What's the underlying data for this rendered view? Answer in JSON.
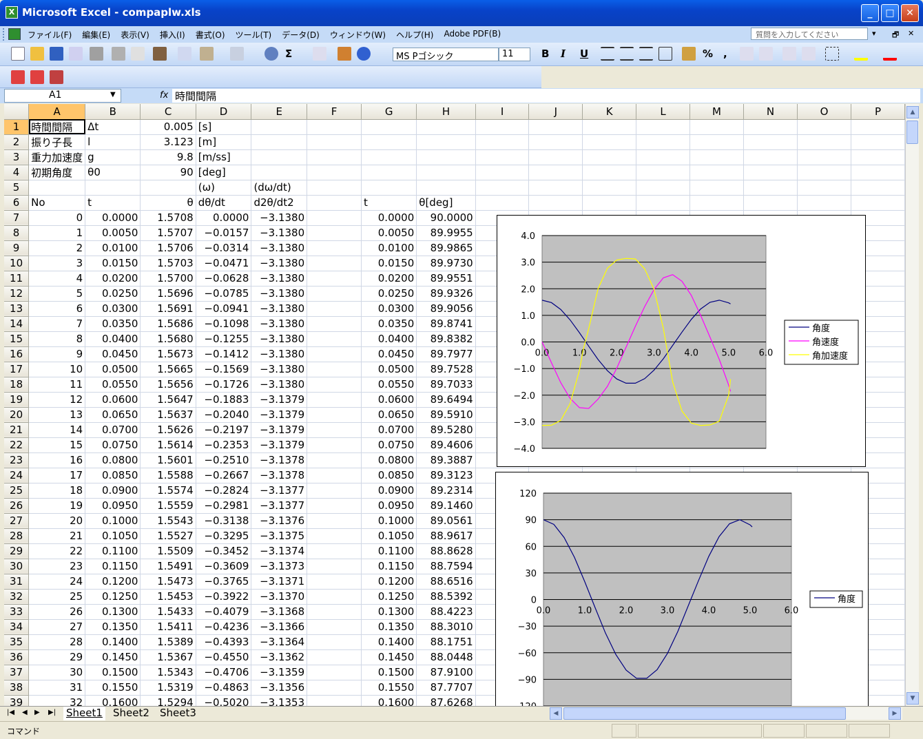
{
  "window": {
    "title": "Microsoft Excel - compaplw.xls",
    "app_icon": "X",
    "minimize": "_",
    "maximize": "□",
    "close": "✕"
  },
  "menu": {
    "items": [
      "ファイル(F)",
      "編集(E)",
      "表示(V)",
      "挿入(I)",
      "書式(O)",
      "ツール(T)",
      "データ(D)",
      "ウィンドウ(W)",
      "ヘルプ(H)",
      "Adobe PDF(B)"
    ],
    "help_placeholder": "質問を入力してください"
  },
  "toolbar": {
    "font_name": "MS Pゴシック",
    "font_size": "11",
    "bold": "B",
    "italic": "I",
    "underline": "U",
    "sigma": "Σ",
    "percent": "%",
    "comma": ","
  },
  "formula_bar": {
    "name_box": "A1",
    "fx": "fx",
    "content": "時間間隔"
  },
  "columns": [
    "A",
    "B",
    "C",
    "D",
    "E",
    "F",
    "G",
    "H",
    "I",
    "J",
    "K",
    "L",
    "M",
    "N",
    "O",
    "P"
  ],
  "rows": [
    [
      "時間間隔",
      "Δt",
      "0.005",
      "[s]",
      "",
      "",
      "",
      ""
    ],
    [
      "振り子長",
      "l",
      "3.123",
      "[m]",
      "",
      "",
      "",
      ""
    ],
    [
      "重力加速度",
      "g",
      "9.8",
      "[m/ss]",
      "",
      "",
      "",
      ""
    ],
    [
      "初期角度",
      "θ0",
      "90",
      "[deg]",
      "",
      "",
      "",
      ""
    ],
    [
      "",
      "",
      "",
      "(ω)",
      "(dω/dt)",
      "",
      "",
      ""
    ],
    [
      "No",
      "t",
      "θ",
      "dθ/dt",
      "d2θ/dt2",
      "",
      "t",
      "θ[deg]"
    ],
    [
      "0",
      "0.0000",
      "1.5708",
      "0.0000",
      "−3.1380",
      "",
      "0.0000",
      "90.0000"
    ],
    [
      "1",
      "0.0050",
      "1.5707",
      "−0.0157",
      "−3.1380",
      "",
      "0.0050",
      "89.9955"
    ],
    [
      "2",
      "0.0100",
      "1.5706",
      "−0.0314",
      "−3.1380",
      "",
      "0.0100",
      "89.9865"
    ],
    [
      "3",
      "0.0150",
      "1.5703",
      "−0.0471",
      "−3.1380",
      "",
      "0.0150",
      "89.9730"
    ],
    [
      "4",
      "0.0200",
      "1.5700",
      "−0.0628",
      "−3.1380",
      "",
      "0.0200",
      "89.9551"
    ],
    [
      "5",
      "0.0250",
      "1.5696",
      "−0.0785",
      "−3.1380",
      "",
      "0.0250",
      "89.9326"
    ],
    [
      "6",
      "0.0300",
      "1.5691",
      "−0.0941",
      "−3.1380",
      "",
      "0.0300",
      "89.9056"
    ],
    [
      "7",
      "0.0350",
      "1.5686",
      "−0.1098",
      "−3.1380",
      "",
      "0.0350",
      "89.8741"
    ],
    [
      "8",
      "0.0400",
      "1.5680",
      "−0.1255",
      "−3.1380",
      "",
      "0.0400",
      "89.8382"
    ],
    [
      "9",
      "0.0450",
      "1.5673",
      "−0.1412",
      "−3.1380",
      "",
      "0.0450",
      "89.7977"
    ],
    [
      "10",
      "0.0500",
      "1.5665",
      "−0.1569",
      "−3.1380",
      "",
      "0.0500",
      "89.7528"
    ],
    [
      "11",
      "0.0550",
      "1.5656",
      "−0.1726",
      "−3.1380",
      "",
      "0.0550",
      "89.7033"
    ],
    [
      "12",
      "0.0600",
      "1.5647",
      "−0.1883",
      "−3.1379",
      "",
      "0.0600",
      "89.6494"
    ],
    [
      "13",
      "0.0650",
      "1.5637",
      "−0.2040",
      "−3.1379",
      "",
      "0.0650",
      "89.5910"
    ],
    [
      "14",
      "0.0700",
      "1.5626",
      "−0.2197",
      "−3.1379",
      "",
      "0.0700",
      "89.5280"
    ],
    [
      "15",
      "0.0750",
      "1.5614",
      "−0.2353",
      "−3.1379",
      "",
      "0.0750",
      "89.4606"
    ],
    [
      "16",
      "0.0800",
      "1.5601",
      "−0.2510",
      "−3.1378",
      "",
      "0.0800",
      "89.3887"
    ],
    [
      "17",
      "0.0850",
      "1.5588",
      "−0.2667",
      "−3.1378",
      "",
      "0.0850",
      "89.3123"
    ],
    [
      "18",
      "0.0900",
      "1.5574",
      "−0.2824",
      "−3.1377",
      "",
      "0.0900",
      "89.2314"
    ],
    [
      "19",
      "0.0950",
      "1.5559",
      "−0.2981",
      "−3.1377",
      "",
      "0.0950",
      "89.1460"
    ],
    [
      "20",
      "0.1000",
      "1.5543",
      "−0.3138",
      "−3.1376",
      "",
      "0.1000",
      "89.0561"
    ],
    [
      "21",
      "0.1050",
      "1.5527",
      "−0.3295",
      "−3.1375",
      "",
      "0.1050",
      "88.9617"
    ],
    [
      "22",
      "0.1100",
      "1.5509",
      "−0.3452",
      "−3.1374",
      "",
      "0.1100",
      "88.8628"
    ],
    [
      "23",
      "0.1150",
      "1.5491",
      "−0.3609",
      "−3.1373",
      "",
      "0.1150",
      "88.7594"
    ],
    [
      "24",
      "0.1200",
      "1.5473",
      "−0.3765",
      "−3.1371",
      "",
      "0.1200",
      "88.6516"
    ],
    [
      "25",
      "0.1250",
      "1.5453",
      "−0.3922",
      "−3.1370",
      "",
      "0.1250",
      "88.5392"
    ],
    [
      "26",
      "0.1300",
      "1.5433",
      "−0.4079",
      "−3.1368",
      "",
      "0.1300",
      "88.4223"
    ],
    [
      "27",
      "0.1350",
      "1.5411",
      "−0.4236",
      "−3.1366",
      "",
      "0.1350",
      "88.3010"
    ],
    [
      "28",
      "0.1400",
      "1.5389",
      "−0.4393",
      "−3.1364",
      "",
      "0.1400",
      "88.1751"
    ],
    [
      "29",
      "0.1450",
      "1.5367",
      "−0.4550",
      "−3.1362",
      "",
      "0.1450",
      "88.0448"
    ],
    [
      "30",
      "0.1500",
      "1.5343",
      "−0.4706",
      "−3.1359",
      "",
      "0.1500",
      "87.9100"
    ],
    [
      "31",
      "0.1550",
      "1.5319",
      "−0.4863",
      "−3.1356",
      "",
      "0.1550",
      "87.7707"
    ],
    [
      "32",
      "0.1600",
      "1.5294",
      "−0.5020",
      "−3.1353",
      "",
      "0.1600",
      "87.6268"
    ]
  ],
  "sheet_tabs": [
    "Sheet1",
    "Sheet2",
    "Sheet3"
  ],
  "status": {
    "mode": "コマンド"
  },
  "chart_data": [
    {
      "type": "line",
      "title": "",
      "xlim": [
        0,
        6
      ],
      "ylim": [
        -4,
        4
      ],
      "xticks": [
        "0.0",
        "1.0",
        "2.0",
        "3.0",
        "4.0",
        "5.0",
        "6.0"
      ],
      "yticks": [
        "4.0",
        "3.0",
        "2.0",
        "1.0",
        "0.0",
        "−1.0",
        "−2.0",
        "−3.0",
        "−4.0"
      ],
      "grid": true,
      "legend": "right",
      "series": [
        {
          "name": "角度",
          "color": "#000080",
          "x": [
            0,
            0.25,
            0.5,
            0.75,
            1.0,
            1.25,
            1.5,
            1.75,
            2.0,
            2.25,
            2.5,
            2.75,
            3.0,
            3.25,
            3.5,
            3.75,
            4.0,
            4.25,
            4.5,
            4.75,
            5.0,
            5.05
          ],
          "y": [
            1.57,
            1.48,
            1.22,
            0.83,
            0.35,
            -0.16,
            -0.66,
            -1.08,
            -1.39,
            -1.55,
            -1.55,
            -1.38,
            -1.06,
            -0.63,
            -0.13,
            0.37,
            0.85,
            1.24,
            1.49,
            1.57,
            1.47,
            1.43
          ]
        },
        {
          "name": "角速度",
          "color": "#ff00ff",
          "x": [
            0,
            0.25,
            0.5,
            0.75,
            1.0,
            1.25,
            1.5,
            1.75,
            2.0,
            2.25,
            2.5,
            2.75,
            3.0,
            3.25,
            3.5,
            3.75,
            4.0,
            4.25,
            4.5,
            4.75,
            5.0,
            5.05
          ],
          "y": [
            0,
            -0.78,
            -1.53,
            -2.12,
            -2.47,
            -2.5,
            -2.15,
            -1.67,
            -0.99,
            -0.2,
            0.59,
            1.33,
            1.97,
            2.41,
            2.53,
            2.28,
            1.75,
            1.0,
            0.18,
            -0.66,
            -1.62,
            -1.86
          ]
        },
        {
          "name": "角加速度",
          "color": "#ffff00",
          "x": [
            0,
            0.25,
            0.5,
            0.75,
            1.0,
            1.1,
            1.25,
            1.5,
            1.75,
            2.0,
            2.25,
            2.5,
            2.75,
            3.0,
            3.25,
            3.5,
            3.75,
            4.0,
            4.25,
            4.5,
            4.75,
            5.0,
            5.05
          ],
          "y": [
            -3.14,
            -3.13,
            -2.95,
            -2.32,
            -1.07,
            -0.3,
            0.5,
            2.0,
            2.77,
            3.08,
            3.14,
            3.12,
            2.75,
            1.98,
            0.51,
            -1.5,
            -2.6,
            -3.05,
            -3.14,
            -3.12,
            -2.98,
            -2.0,
            -1.4
          ]
        }
      ]
    },
    {
      "type": "line",
      "title": "",
      "xlim": [
        0,
        6
      ],
      "ylim": [
        -120,
        120
      ],
      "xticks": [
        "0.0",
        "1.0",
        "2.0",
        "3.0",
        "4.0",
        "5.0",
        "6.0"
      ],
      "yticks": [
        "120",
        "90",
        "60",
        "30",
        "0",
        "−30",
        "−60",
        "−90",
        "−120"
      ],
      "grid": true,
      "legend": "right",
      "series": [
        {
          "name": "角度",
          "color": "#000080",
          "x": [
            0,
            0.25,
            0.5,
            0.75,
            1.0,
            1.25,
            1.5,
            1.75,
            2.0,
            2.25,
            2.5,
            2.75,
            3.0,
            3.25,
            3.5,
            3.75,
            4.0,
            4.25,
            4.5,
            4.75,
            5.0,
            5.05
          ],
          "y": [
            90,
            84.8,
            69.9,
            47.6,
            20,
            -9.2,
            -37.8,
            -61.9,
            -79.6,
            -88.8,
            -88.8,
            -79.1,
            -60.7,
            -36.1,
            -7.4,
            21.2,
            48.7,
            71,
            85.4,
            90,
            84.2,
            81.9
          ]
        }
      ]
    }
  ]
}
